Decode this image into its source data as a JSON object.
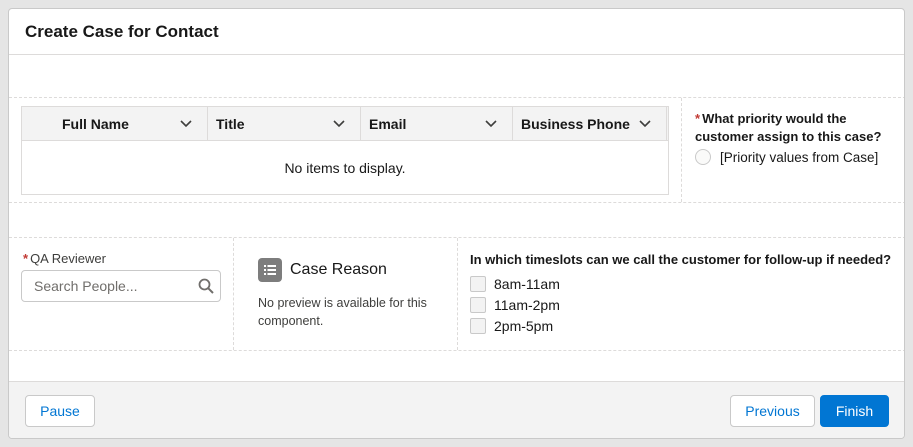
{
  "header": {
    "title": "Create Case for Contact"
  },
  "table": {
    "columns": [
      "Full Name",
      "Title",
      "Email",
      "Business Phone"
    ],
    "empty_message": "No items to display."
  },
  "priority": {
    "required_marker": "*",
    "question": "What priority would the customer assign to this case?",
    "option": "[Priority values from Case]"
  },
  "qa_reviewer": {
    "required_marker": "*",
    "label": "QA Reviewer",
    "placeholder": "Search People..."
  },
  "case_reason": {
    "title": "Case Reason",
    "message": "No preview is available for this component."
  },
  "timeslots": {
    "question": "In which timeslots can we call the customer for follow-up if needed?",
    "options": [
      "8am-11am",
      "11am-2pm",
      "2pm-5pm"
    ]
  },
  "footer": {
    "pause_label": "Pause",
    "previous_label": "Previous",
    "finish_label": "Finish"
  },
  "colors": {
    "brand": "#0176d3",
    "required": "#c23934"
  }
}
